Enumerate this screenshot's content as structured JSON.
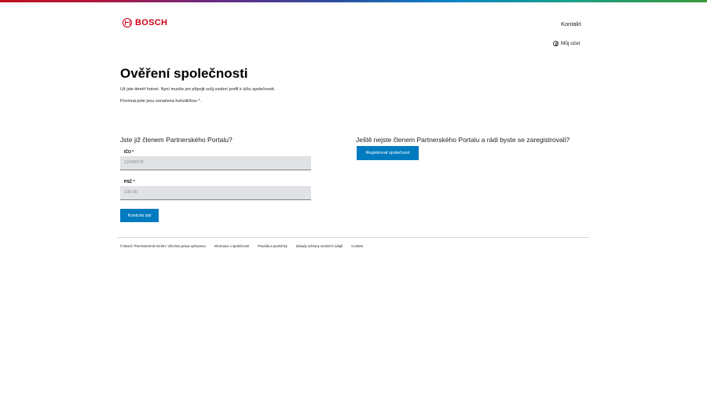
{
  "header": {
    "brand": "BOSCH",
    "nav": {
      "contact": "Kontakt"
    },
    "account_label": "Můj účet"
  },
  "page": {
    "title": "Ověření společnosti",
    "intro": "Už jste téměř hotovi. Nyní musíte jen připojit svůj osobní profil k účtu společnosti.",
    "required_note": "Povinná pole jsou označena hvězdičkou *."
  },
  "member_form": {
    "heading": "Jste již členem Partnerského Portalu?",
    "fields": [
      {
        "label": "IČO *",
        "placeholder": "12345678"
      },
      {
        "label": "PSČ *",
        "placeholder": "108 00"
      }
    ],
    "submit_label": "Kontrola dat"
  },
  "register": {
    "heading": "Ještě nejste členem Partnerského Portalu a rádi byste se zaregistrovali?",
    "button_label": "Registrovat společnost"
  },
  "footer": {
    "links": [
      "© Bosch Thermotechnik GmbH, Všechna práva vyhrazena",
      "Informace o společnosti",
      "Pravidla a podmínky",
      "Zásady ochrany osobních údajů",
      "Cookies"
    ]
  },
  "colors": {
    "brand_red": "#d10019",
    "primary_button": "#007bc0",
    "input_background": "#e0e2e5"
  },
  "icons": [
    "bosch-logo-icon",
    "user-icon"
  ]
}
